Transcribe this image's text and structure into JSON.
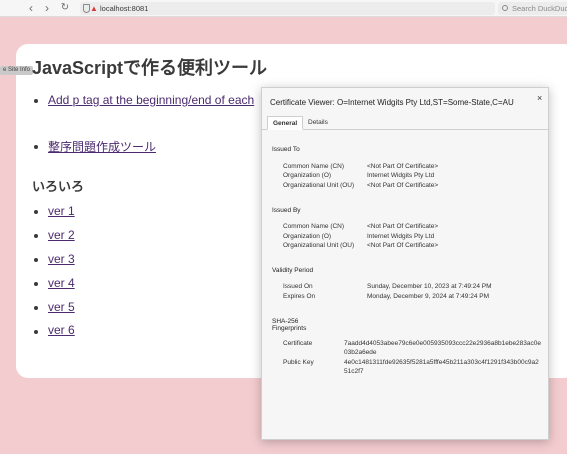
{
  "browser": {
    "url": "localhost:8081",
    "search_placeholder": "Search DuckDuckGo"
  },
  "page": {
    "site_info_label": "e Site Info",
    "title": "JavaScriptで作る便利ツール",
    "links_top": [
      {
        "label": "Add p tag at the beginning/end of each"
      },
      {
        "label": "整序問題作成ツール"
      }
    ],
    "section_heading": "いろいろ",
    "version_links": [
      {
        "label": "ver 1"
      },
      {
        "label": "ver 2"
      },
      {
        "label": "ver 3"
      },
      {
        "label": "ver 4"
      },
      {
        "label": "ver 5"
      },
      {
        "label": "ver 6"
      }
    ]
  },
  "certificate_viewer": {
    "title": "Certificate Viewer: O=Internet Widgits Pty Ltd,ST=Some-State,C=AU",
    "close_label": "×",
    "tabs": [
      {
        "label": "General",
        "active": true
      },
      {
        "label": "Details",
        "active": false
      }
    ],
    "issued_to": {
      "heading": "Issued To",
      "fields": [
        {
          "label": "Common Name (CN)",
          "value": "<Not Part Of Certificate>"
        },
        {
          "label": "Organization (O)",
          "value": "Internet Widgits Pty Ltd"
        },
        {
          "label": "Organizational Unit (OU)",
          "value": "<Not Part Of Certificate>"
        }
      ]
    },
    "issued_by": {
      "heading": "Issued By",
      "fields": [
        {
          "label": "Common Name (CN)",
          "value": "<Not Part Of Certificate>"
        },
        {
          "label": "Organization (O)",
          "value": "Internet Widgits Pty Ltd"
        },
        {
          "label": "Organizational Unit (OU)",
          "value": "<Not Part Of Certificate>"
        }
      ]
    },
    "validity": {
      "heading": "Validity Period",
      "fields": [
        {
          "label": "Issued On",
          "value": "Sunday, December 10, 2023 at 7:49:24 PM"
        },
        {
          "label": "Expires On",
          "value": "Monday, December 9, 2024 at 7:49:24 PM"
        }
      ]
    },
    "fingerprints": {
      "heading_line1": "SHA-256",
      "heading_line2": "Fingerprints",
      "fields": [
        {
          "label": "Certificate",
          "value": "7aadd4d4053abee79c6e0e005935093ccc22e2936a8b1ebe283ac0e03b2a6ede"
        },
        {
          "label": "Public Key",
          "value": "4e0c1481311fde92635f5281a5fffe45b211a303c4f1291f343b00c9a251c2f7"
        }
      ]
    }
  }
}
